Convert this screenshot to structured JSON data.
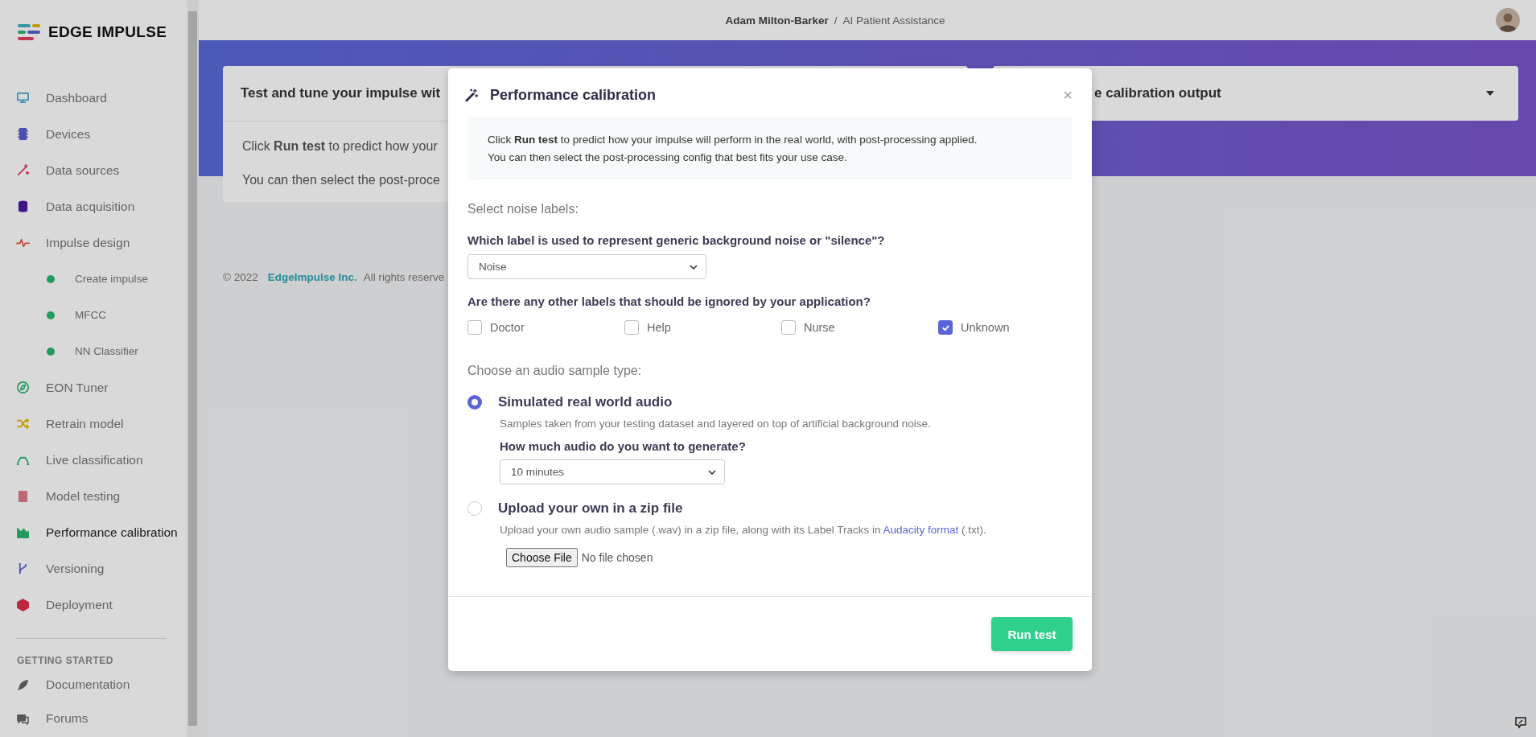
{
  "brand": {
    "logo": "EDGE IMPULSE"
  },
  "sidebar": {
    "items": [
      {
        "label": "Dashboard",
        "selected": false
      },
      {
        "label": "Devices",
        "selected": false
      },
      {
        "label": "Data sources",
        "selected": false
      },
      {
        "label": "Data acquisition",
        "selected": false
      },
      {
        "label": "Impulse design",
        "selected": false,
        "children": [
          {
            "label": "Create impulse",
            "selected": false
          },
          {
            "label": "MFCC",
            "selected": false
          },
          {
            "label": "NN Classifier",
            "selected": false
          }
        ]
      },
      {
        "label": "EON Tuner",
        "selected": false
      },
      {
        "label": "Retrain model",
        "selected": false
      },
      {
        "label": "Live classification",
        "selected": false
      },
      {
        "label": "Model testing",
        "selected": false
      },
      {
        "label": "Performance calibration",
        "selected": true
      },
      {
        "label": "Versioning",
        "selected": false
      },
      {
        "label": "Deployment",
        "selected": false
      }
    ],
    "section": {
      "heading": "GETTING STARTED",
      "items": [
        {
          "label": "Documentation",
          "selected": false
        },
        {
          "label": "Forums",
          "selected": false
        }
      ]
    }
  },
  "topbar": {
    "user": "Adam Milton-Barker",
    "separator": "/",
    "project": "AI Patient Assistance"
  },
  "left_card": {
    "title": "Test and tune your impulse wit",
    "lines": [
      "Click **Run test** to predict how your",
      "You can then select the post-proce"
    ]
  },
  "right_card": {
    "title": "e calibration output"
  },
  "footer": {
    "copyright": "© 2022",
    "company": "EdgeImpulse Inc.",
    "rights": "All rights reserve"
  },
  "modal": {
    "title": "Performance calibration",
    "close": "×",
    "info": [
      "Click **Run test** to predict how your impulse will perform in the real world, with post-processing applied.",
      "You can then select the post-processing config that best fits your use case."
    ],
    "noise_heading": "Select noise labels:",
    "noise_question": "Which label is used to represent generic background noise or \"silence\"?",
    "noise_select": "Noise",
    "ignore_question": "Are there any other labels that should be ignored by your application?",
    "ignore_labels": [
      {
        "label": "Doctor",
        "checked": false
      },
      {
        "label": "Help",
        "checked": false
      },
      {
        "label": "Nurse",
        "checked": false
      },
      {
        "label": "Unknown",
        "checked": true
      }
    ],
    "sample_heading": "Choose an audio sample type:",
    "options": [
      {
        "kind": "simulated",
        "title": "Simulated real world audio",
        "selected": true,
        "description": "Samples taken from your testing dataset and layered on top of artificial background noise.",
        "question": "How much audio do you want to generate?",
        "select": "10 minutes"
      },
      {
        "kind": "upload",
        "title": "Upload your own in a zip file",
        "selected": false,
        "description": "Upload your own audio sample (.wav) in a zip file, along with its Label Tracks in",
        "link": "Audacity format",
        "after": "(.txt).",
        "file_button": "Choose File",
        "file_status": "No file chosen"
      }
    ],
    "run_button": "Run test"
  }
}
